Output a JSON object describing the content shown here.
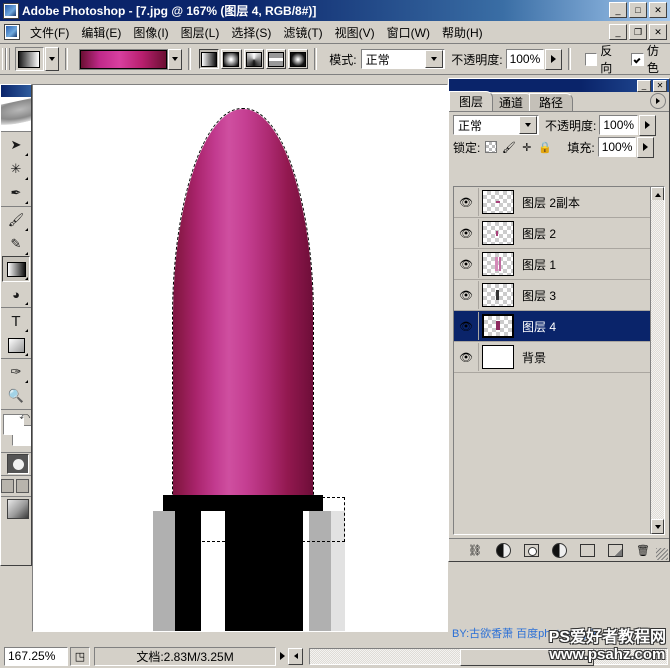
{
  "window": {
    "title": "Adobe Photoshop - [7.jpg @ 167% (图层 4, RGB/8#)]",
    "app_icon": "photoshop-logo-icon",
    "minimize": "_",
    "maximize": "□",
    "close": "✕",
    "doc_minimize": "_",
    "doc_restore": "❐",
    "doc_close": "✕"
  },
  "menu": {
    "items": [
      {
        "label": "文件(F)"
      },
      {
        "label": "编辑(E)"
      },
      {
        "label": "图像(I)"
      },
      {
        "label": "图层(L)"
      },
      {
        "label": "选择(S)"
      },
      {
        "label": "滤镜(T)"
      },
      {
        "label": "视图(V)"
      },
      {
        "label": "窗口(W)"
      },
      {
        "label": "帮助(H)"
      }
    ]
  },
  "options_bar": {
    "tool_preset_icon": "gradient-tool-icon",
    "preset_dropdown_icon": "chevron-down-icon",
    "gradient_swatch_name": "gradient-preview",
    "gradient_dropdown_icon": "chevron-down-icon",
    "gradient_types": [
      {
        "name": "linear-gradient-icon",
        "active": true
      },
      {
        "name": "radial-gradient-icon",
        "active": false
      },
      {
        "name": "angle-gradient-icon",
        "active": false
      },
      {
        "name": "reflected-gradient-icon",
        "active": false
      },
      {
        "name": "diamond-gradient-icon",
        "active": false
      }
    ],
    "mode_label": "模式:",
    "mode_value": "正常",
    "opacity_label": "不透明度:",
    "opacity_value": "100%",
    "reverse_label": "反向",
    "reverse_checked": false,
    "dither_label": "仿色",
    "dither_checked": true
  },
  "toolbox": {
    "tools": [
      {
        "name": "move-tool-icon",
        "glyph": "➤",
        "selected": false
      },
      {
        "name": "magic-wand-tool-icon",
        "glyph": "✳",
        "selected": false
      },
      {
        "name": "lasso-tool-icon",
        "glyph": "✒",
        "selected": false
      },
      {
        "name": "brush-tool-icon",
        "glyph": "🖌",
        "selected": false
      },
      {
        "name": "healing-brush-tool-icon",
        "glyph": "✎",
        "selected": false
      },
      {
        "name": "gradient-tool-icon",
        "glyph": "",
        "selected": true
      },
      {
        "name": "blur-tool-icon",
        "glyph": "◔",
        "selected": false
      },
      {
        "name": "type-tool-icon",
        "glyph": "T",
        "selected": false
      },
      {
        "name": "shape-tool-icon",
        "glyph": "▭",
        "selected": false
      },
      {
        "name": "eyedropper-tool-icon",
        "glyph": "✑",
        "selected": false
      },
      {
        "name": "zoom-tool-icon",
        "glyph": "🔍",
        "selected": false
      }
    ],
    "foreground_color": "#ffffff",
    "background_color": "#ffffff",
    "swap-colors-icon": "⤾",
    "quickmask_icon": "quick-mask-icon",
    "screenmode_icons": [
      "standard-screen-icon",
      "full-screen-icon"
    ],
    "jump_to_imageready_icon": "jump-to-imageready-icon"
  },
  "layers_panel": {
    "titlebar_minimize": "_",
    "titlebar_close": "✕",
    "tabs": [
      {
        "label": "图层",
        "active": true
      },
      {
        "label": "通道",
        "active": false
      },
      {
        "label": "路径",
        "active": false
      }
    ],
    "menu_icon": "palette-menu-icon",
    "blend_mode": "正常",
    "opacity_label": "不透明度:",
    "opacity_value": "100%",
    "lock_label": "锁定:",
    "lock_icons": [
      {
        "name": "lock-transparent-pixels-icon"
      },
      {
        "name": "lock-image-pixels-icon",
        "glyph": "🖌"
      },
      {
        "name": "lock-position-icon",
        "glyph": "✛"
      },
      {
        "name": "lock-all-icon",
        "glyph": "🔒"
      }
    ],
    "fill_label": "填充:",
    "fill_value": "100%",
    "layers": [
      {
        "name": "图层 2副本",
        "visible": true,
        "selected": false,
        "thumb": "transparent"
      },
      {
        "name": "图层 2",
        "visible": true,
        "selected": false,
        "thumb": "transparent"
      },
      {
        "name": "图层 1",
        "visible": true,
        "selected": false,
        "thumb": "transparent"
      },
      {
        "name": "图层 3",
        "visible": true,
        "selected": false,
        "thumb": "transparent"
      },
      {
        "name": "图层 4",
        "visible": true,
        "selected": true,
        "thumb": "transparent"
      },
      {
        "name": "背景",
        "visible": true,
        "selected": false,
        "thumb": "white"
      }
    ],
    "eye_icon": "eye-visibility-icon",
    "bottom_buttons": [
      {
        "name": "link-layers-icon",
        "glyph": "⛓"
      },
      {
        "name": "layer-style-icon",
        "glyph": "ƒ"
      },
      {
        "name": "layer-mask-icon",
        "glyph": ""
      },
      {
        "name": "adjustment-layer-icon",
        "glyph": ""
      },
      {
        "name": "new-group-icon",
        "glyph": ""
      },
      {
        "name": "new-layer-icon",
        "glyph": "▣"
      },
      {
        "name": "delete-layer-icon",
        "glyph": "🗑"
      }
    ],
    "scroll_up_icon": "scroll-up-arrow",
    "scroll_down_icon": "scroll-down-arrow"
  },
  "canvas": {
    "artwork_name": "lipstick-artwork",
    "selection_name": "marching-ants-selection",
    "colors": {
      "lipstick_dark": "#6d0d38",
      "lipstick_mid": "#a8236a",
      "lipstick_light": "#cf4fa0",
      "tube_black": "#000000",
      "tube_gray": "#b0b0b0",
      "tube_white": "#ffffff"
    }
  },
  "status_bar": {
    "zoom_value": "167.25%",
    "preview_icon": "document-preview-icon",
    "doc_info": "文档:2.83M/3.25M",
    "info_popup_icon": "right-triangle-icon",
    "scroll_left_icon": "left-arrow-icon"
  },
  "watermarks": {
    "credit": "BY:古欲香萧    百度photoshop吧",
    "site_line1": "PS爱好者教程网",
    "site_line2": "www.psahz.com"
  }
}
